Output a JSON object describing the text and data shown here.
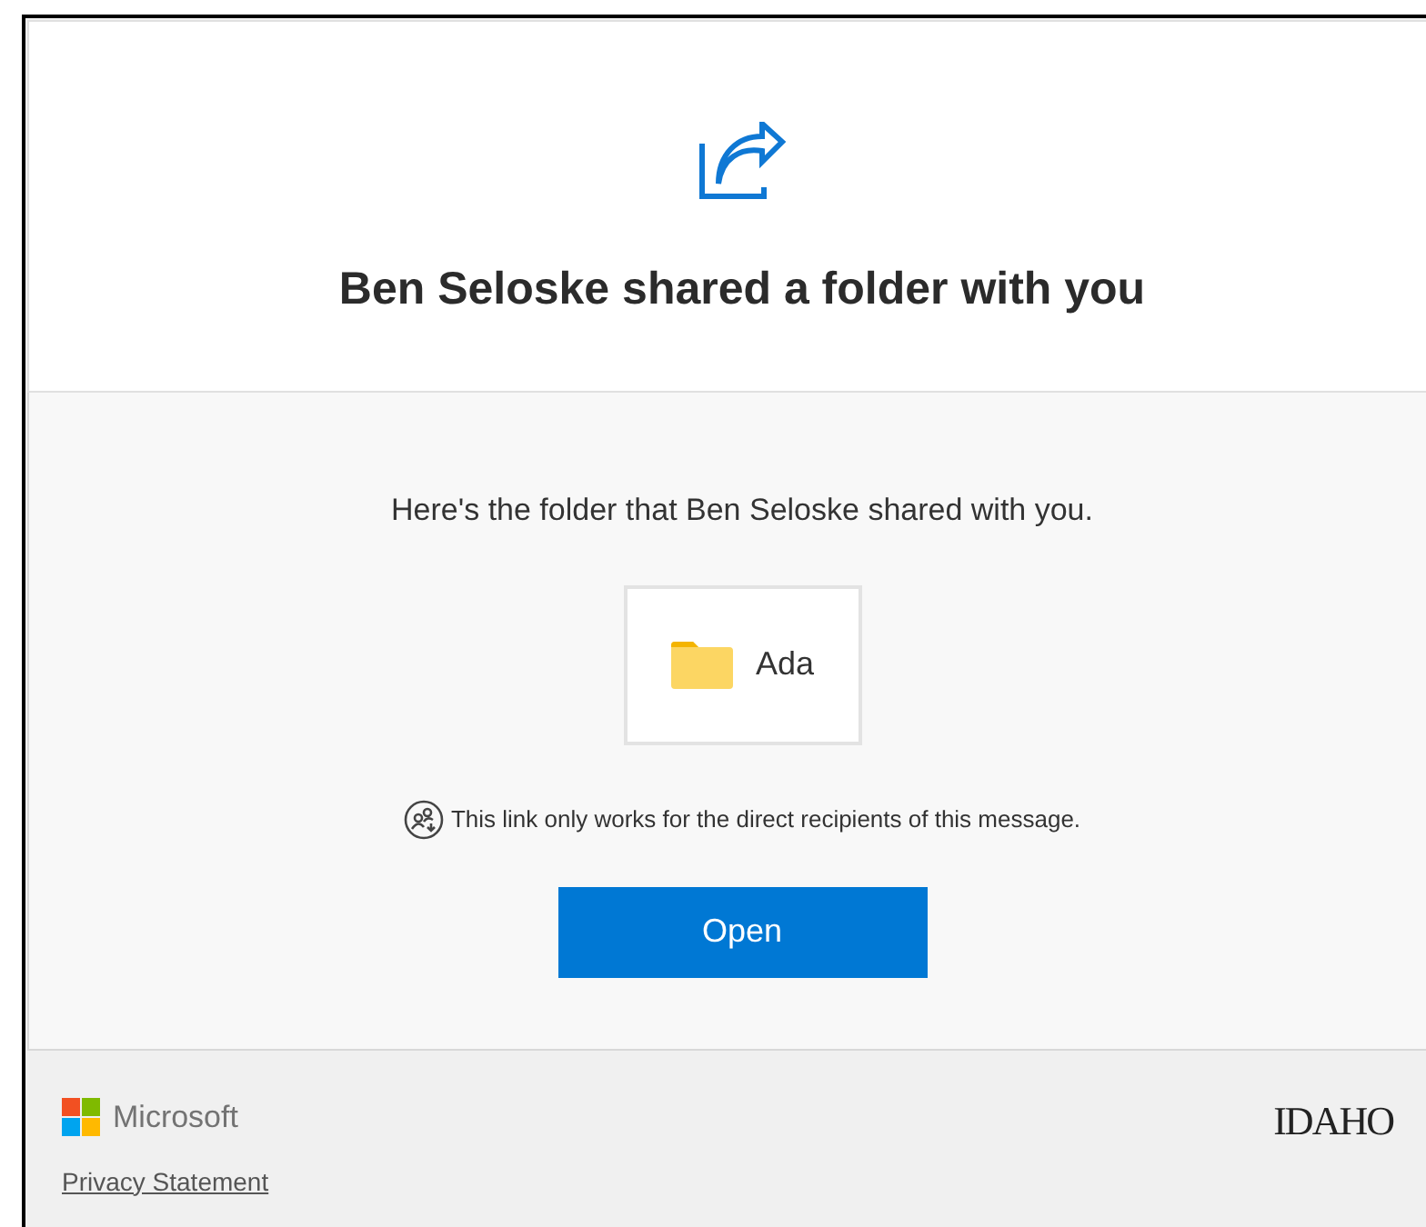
{
  "header": {
    "title": "Ben Seloske shared a folder with you"
  },
  "body": {
    "message": "Here's the folder that Ben Seloske shared with you.",
    "item": {
      "name": "Ada"
    },
    "notice": "This link only works for the direct recipients of this message.",
    "button": "Open"
  },
  "footer": {
    "brand": "Microsoft",
    "link": "Privacy Statement",
    "logo": "IDAHO"
  }
}
